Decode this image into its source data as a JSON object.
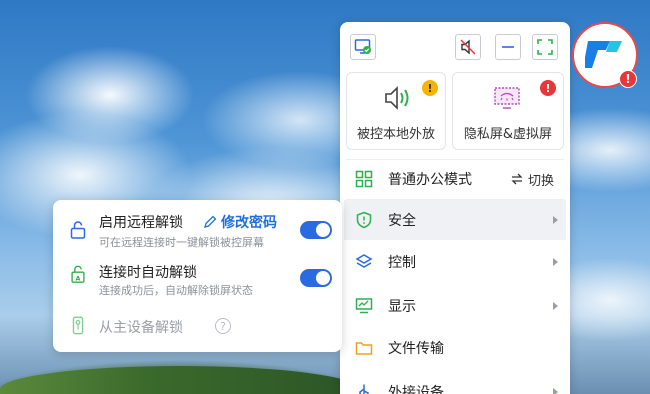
{
  "toolbar": {
    "screen_icon": "screen-check-icon",
    "mute_icon": "speaker-muted-icon",
    "minimize_icon": "minimize-icon",
    "fullscreen_icon": "fullscreen-icon"
  },
  "tiles": [
    {
      "label": "被控本地外放",
      "icon": "speaker-icon",
      "badge": "!",
      "badge_color": "#f5b400"
    },
    {
      "label": "隐私屏&虚拟屏",
      "icon": "privacy-screen-icon",
      "badge": "!",
      "badge_color": "#e8373a"
    }
  ],
  "mode": {
    "label": "普通办公模式",
    "switch_label": "切换"
  },
  "menu": [
    {
      "label": "安全",
      "icon": "shield-icon",
      "has_submenu": true,
      "active": true
    },
    {
      "label": "控制",
      "icon": "layers-icon",
      "has_submenu": true
    },
    {
      "label": "显示",
      "icon": "monitor-icon",
      "has_submenu": true
    },
    {
      "label": "文件传输",
      "icon": "folder-icon",
      "has_submenu": false
    },
    {
      "label": "外接设备",
      "icon": "usb-icon",
      "has_submenu": true
    }
  ],
  "app_badge": "!",
  "security_submenu": {
    "remote_unlock": {
      "title": "启用远程解锁",
      "desc": "可在远程连接时一键解锁被控屏幕",
      "enabled": true
    },
    "change_password": "修改密码",
    "auto_unlock": {
      "title": "连接时自动解锁",
      "desc": "连接成功后，自动解除锁屏状态",
      "enabled": true
    },
    "device_unlock": {
      "title": "从主设备解锁"
    },
    "help": "?"
  },
  "colors": {
    "accent": "#2a6be0",
    "green_icon": "#2bb24c",
    "warning": "#f5b400",
    "danger": "#e8373a"
  }
}
